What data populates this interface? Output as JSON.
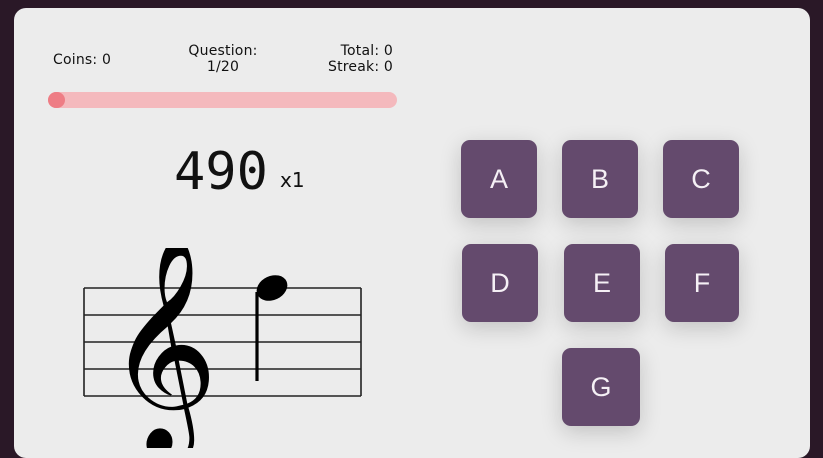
{
  "stats": {
    "coins": "Coins: 0",
    "question_label": "Question:",
    "question_value": "1/20",
    "total": "Total: 0",
    "streak": "Streak: 0"
  },
  "progress": {
    "fraction": 0.05
  },
  "score": {
    "value": "490",
    "multiplier": "x1"
  },
  "staff": {
    "clef": "treble-clef-icon",
    "note": "quarter-note-icon"
  },
  "answers": [
    "A",
    "B",
    "C",
    "D",
    "E",
    "F",
    "G"
  ],
  "colors": {
    "background": "#2a1827",
    "card": "#ececec",
    "button": "#644a6d",
    "progress_track": "#f4b9bd",
    "progress_fill": "#ee7d85"
  }
}
